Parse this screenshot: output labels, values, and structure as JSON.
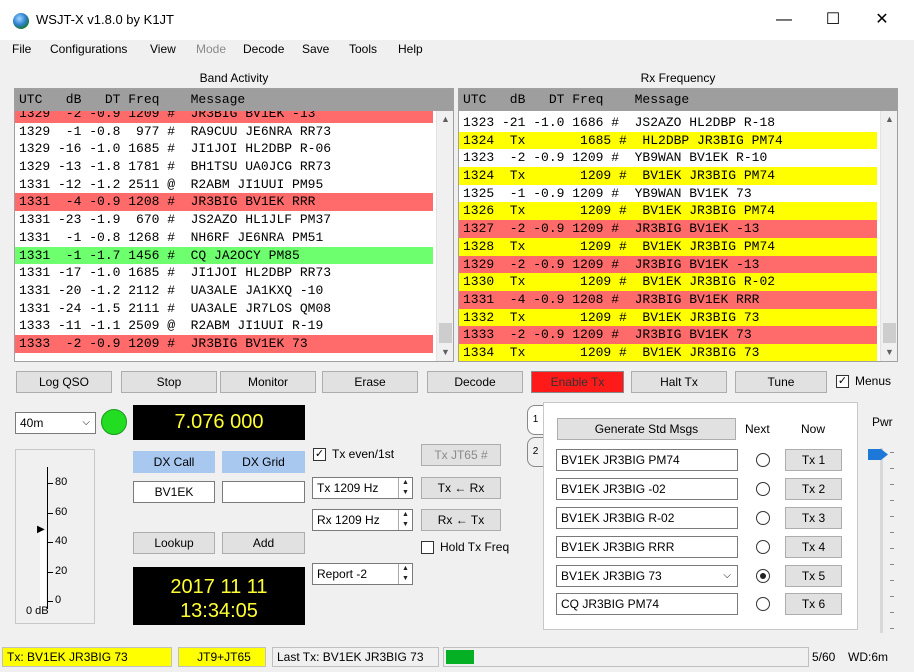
{
  "window": {
    "title": "WSJT-X   v1.8.0   by K1JT",
    "minimize": "—",
    "maximize": "☐",
    "close": "✕"
  },
  "menu": [
    "File",
    "Configurations",
    "View",
    "Mode",
    "Decode",
    "Save",
    "Tools",
    "Help"
  ],
  "band_activity": {
    "title": "Band Activity",
    "header": "UTC   dB   DT Freq    Message",
    "rows": [
      {
        "text": "1329  -2 -0.9 1209 #  JR3BIG BV1EK -13",
        "style": "red"
      },
      {
        "text": "1329  -1 -0.8  977 #  RA9CUU JE6NRA RR73",
        "style": ""
      },
      {
        "text": "1329 -16 -1.0 1685 #  JI1JOI HL2DBP R-06",
        "style": ""
      },
      {
        "text": "1329 -13 -1.8 1781 #  BH1TSU UA0JCG RR73",
        "style": ""
      },
      {
        "text": "1331 -12 -1.2 2511 @  R2ABM JI1UUI PM95",
        "style": ""
      },
      {
        "text": "1331  -4 -0.9 1208 #  JR3BIG BV1EK RRR",
        "style": "red"
      },
      {
        "text": "1331 -23 -1.9  670 #  JS2AZO HL1JLF PM37",
        "style": ""
      },
      {
        "text": "1331  -1 -0.8 1268 #  NH6RF JE6NRA PM51",
        "style": ""
      },
      {
        "text": "1331  -1 -1.7 1456 #  CQ JA2OCY PM85",
        "style": "green"
      },
      {
        "text": "1331 -17 -1.0 1685 #  JI1JOI HL2DBP RR73",
        "style": ""
      },
      {
        "text": "1331 -20 -1.2 2112 #  UA3ALE JA1KXQ -10",
        "style": ""
      },
      {
        "text": "1331 -24 -1.5 2111 #  UA3ALE JR7LOS QM08",
        "style": ""
      },
      {
        "text": "1333 -11 -1.1 2509 @  R2ABM JI1UUI R-19",
        "style": ""
      },
      {
        "text": "1333  -2 -0.9 1209 #  JR3BIG BV1EK 73",
        "style": "red"
      }
    ]
  },
  "rx_frequency": {
    "title": "Rx Frequency",
    "header": "UTC   dB   DT Freq    Message",
    "rows": [
      {
        "text": "1323 -21 -1.0 1686 #  JS2AZO HL2DBP R-18",
        "style": ""
      },
      {
        "text": "1324  Tx       1685 #  HL2DBP JR3BIG PM74",
        "style": "yellow"
      },
      {
        "text": "1323  -2 -0.9 1209 #  YB9WAN BV1EK R-10",
        "style": ""
      },
      {
        "text": "1324  Tx       1209 #  BV1EK JR3BIG PM74",
        "style": "yellow"
      },
      {
        "text": "1325  -1 -0.9 1209 #  YB9WAN BV1EK 73",
        "style": ""
      },
      {
        "text": "1326  Tx       1209 #  BV1EK JR3BIG PM74",
        "style": "yellow"
      },
      {
        "text": "1327  -2 -0.9 1209 #  JR3BIG BV1EK -13",
        "style": "red"
      },
      {
        "text": "1328  Tx       1209 #  BV1EK JR3BIG PM74",
        "style": "yellow"
      },
      {
        "text": "1329  -2 -0.9 1209 #  JR3BIG BV1EK -13",
        "style": "red"
      },
      {
        "text": "1330  Tx       1209 #  BV1EK JR3BIG R-02",
        "style": "yellow"
      },
      {
        "text": "1331  -4 -0.9 1208 #  JR3BIG BV1EK RRR",
        "style": "red"
      },
      {
        "text": "1332  Tx       1209 #  BV1EK JR3BIG 73",
        "style": "yellow"
      },
      {
        "text": "1333  -2 -0.9 1209 #  JR3BIG BV1EK 73",
        "style": "red"
      },
      {
        "text": "1334  Tx       1209 #  BV1EK JR3BIG 73",
        "style": "yellow"
      }
    ]
  },
  "buttons": {
    "log_qso": "Log QSO",
    "stop": "Stop",
    "monitor": "Monitor",
    "erase": "Erase",
    "decode": "Decode",
    "enable_tx": "Enable Tx",
    "halt_tx": "Halt Tx",
    "tune": "Tune",
    "menus": "Menus"
  },
  "band": "40m",
  "dial_freq": "7.076 000",
  "dx_call_label": "DX Call",
  "dx_grid_label": "DX Grid",
  "dx_call_value": "BV1EK",
  "dx_grid_value": "",
  "lookup": "Lookup",
  "add": "Add",
  "clock_date": "2017 11 11",
  "clock_time": "13:34:05",
  "tx_even": "Tx even/1st",
  "tx_jt65": "Tx JT65  #",
  "tx_freq": "Tx  1209  Hz",
  "rx_freq": "Rx  1209  Hz",
  "tx_from_rx": "Tx ← Rx",
  "rx_from_tx": "Rx ← Tx",
  "hold_tx_freq": "Hold Tx Freq",
  "report": "Report -2",
  "meter": {
    "ticks": [
      "80",
      "60",
      "40",
      "20",
      "0"
    ],
    "unit": "0 dB",
    "level": 0.55
  },
  "tabs": [
    "1",
    "2"
  ],
  "generate_std_msgs": "Generate Std Msgs",
  "next_label": "Next",
  "now_label": "Now",
  "pwr_label": "Pwr",
  "messages": [
    {
      "text": "BV1EK JR3BIG PM74",
      "tx": "Tx 1",
      "selected": false,
      "dropdown": false
    },
    {
      "text": "BV1EK JR3BIG -02",
      "tx": "Tx 2",
      "selected": false,
      "dropdown": false
    },
    {
      "text": "BV1EK JR3BIG R-02",
      "tx": "Tx 3",
      "selected": false,
      "dropdown": false
    },
    {
      "text": "BV1EK JR3BIG RRR",
      "tx": "Tx 4",
      "selected": false,
      "dropdown": false
    },
    {
      "text": "BV1EK JR3BIG 73",
      "tx": "Tx 5",
      "selected": true,
      "dropdown": true
    },
    {
      "text": "CQ JR3BIG PM74",
      "tx": "Tx 6",
      "selected": false,
      "dropdown": false
    }
  ],
  "status": {
    "tx": "Tx: BV1EK JR3BIG 73",
    "mode": "JT9+JT65",
    "last_tx": "Last Tx: BV1EK JR3BIG 73",
    "progress": "5/60",
    "wd": "WD:6m"
  },
  "colors": {
    "red_row": "#ff6b6b",
    "green_row": "#6dff6d",
    "yellow_row": "#ffff00",
    "enable_tx": "#ff1a1a",
    "monitor_led": "#22dd22",
    "lcd_text": "#ffff33"
  }
}
